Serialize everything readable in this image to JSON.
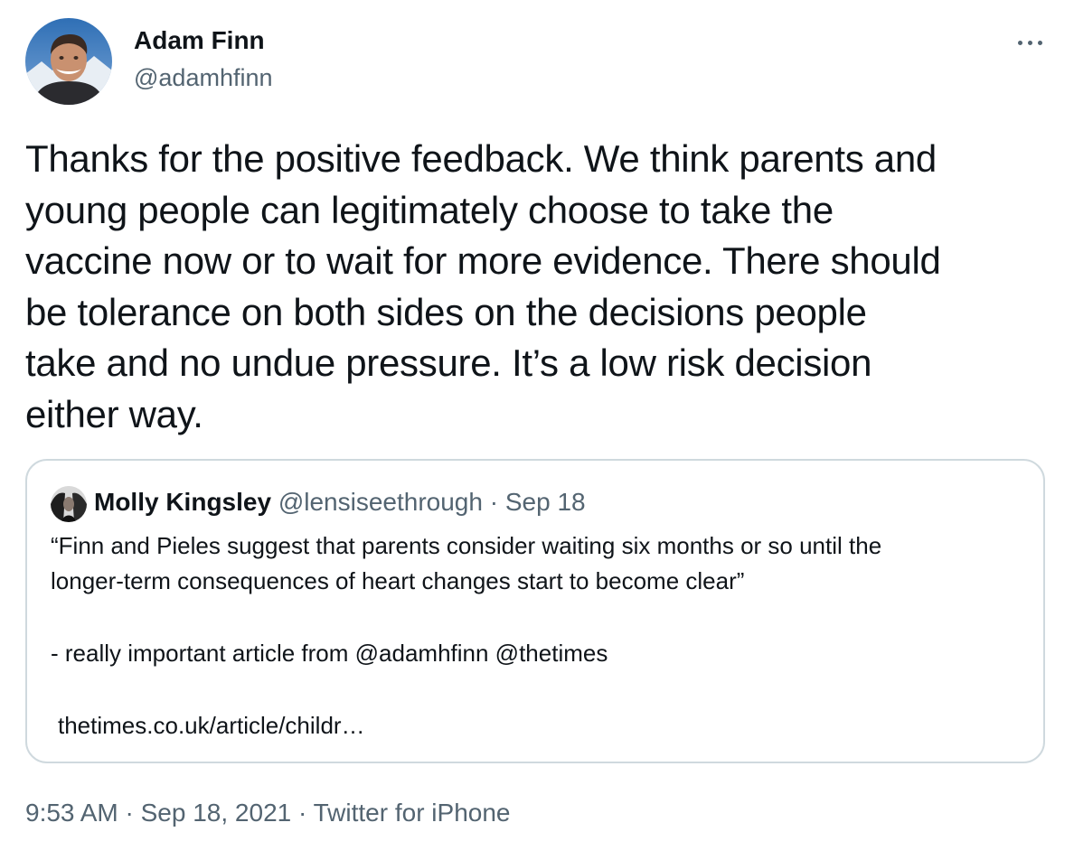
{
  "author": {
    "name": "Adam Finn",
    "handle": "@adamhfinn",
    "avatar_icon": "user-avatar-photo"
  },
  "tweet": {
    "text_lines": [
      "Thanks for the positive feedback. We think parents and",
      "young people can legitimately choose to take the",
      "vaccine now or to wait for more evidence. There should",
      "be tolerance on both sides on the decisions people",
      "take and no undue pressure. It’s a low risk decision",
      "either way."
    ]
  },
  "more_icon": "more-horizontal-icon",
  "quoted_tweet": {
    "name": "Molly Kingsley",
    "handle": "@lensiseethrough",
    "separator": "·",
    "date": "Sep 18",
    "line1": "“Finn and Pieles suggest that parents consider waiting six months or so until the",
    "line2": "longer-term consequences of heart changes start to become clear”",
    "line3": "- really important article from @adamhfinn @thetimes",
    "link": "thetimes.co.uk/article/childr…"
  },
  "footer": {
    "time": "9:53 AM",
    "separator": "·",
    "date": "Sep 18, 2021",
    "source": "Twitter for iPhone"
  },
  "colors": {
    "text": "#0f1419",
    "secondary": "#536471",
    "border": "#cfd9de"
  }
}
